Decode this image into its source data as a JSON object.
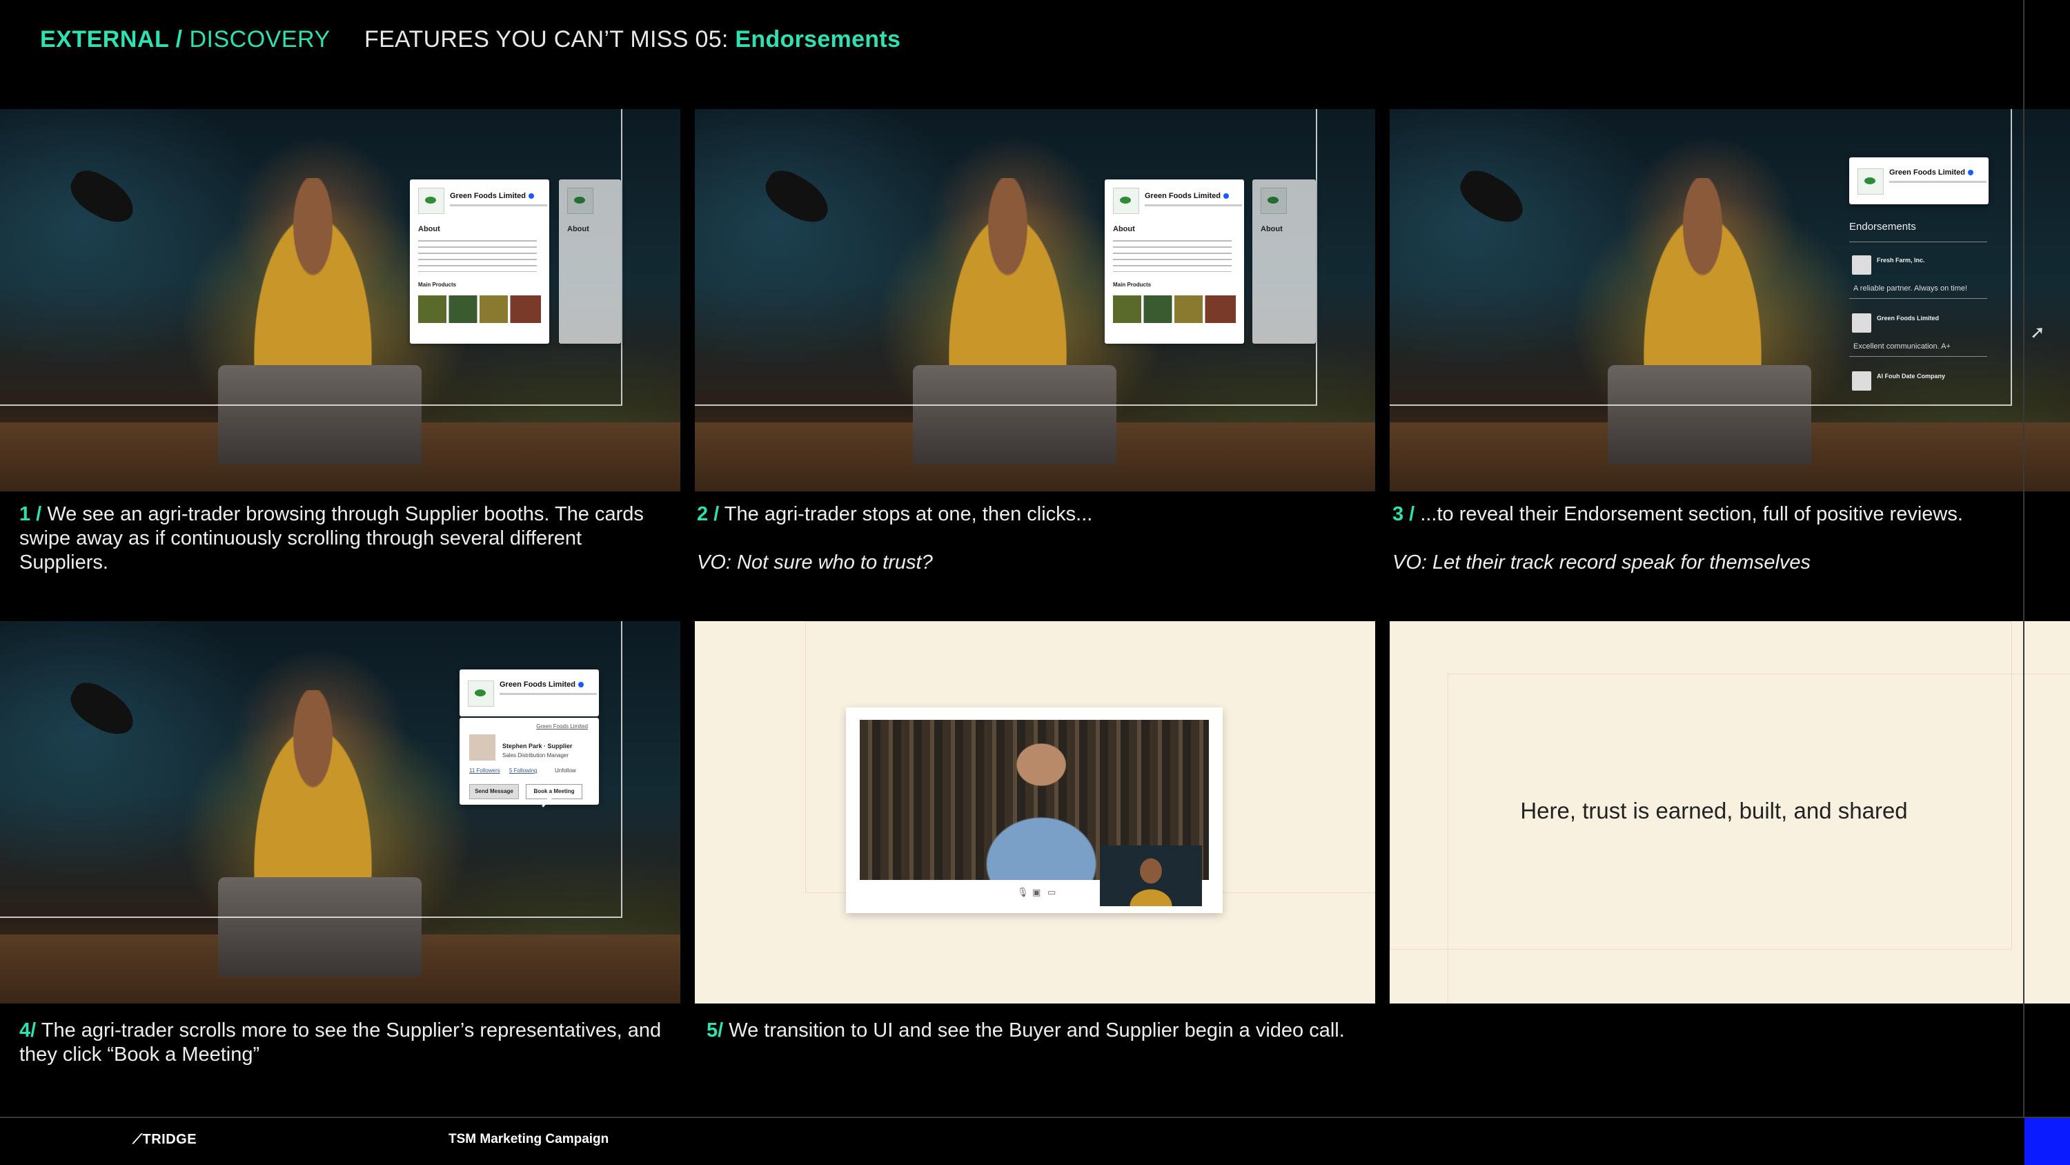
{
  "header": {
    "section_bold": "EXTERNAL /",
    "section_light": "DISCOVERY",
    "feature_prefix": "FEATURES YOU CAN’T MISS 05:",
    "feature_highlight": "Endorsements"
  },
  "panels": [
    {
      "num": "1 /",
      "text": "We see an agri-trader browsing through Supplier booths. The cards swipe away as if continuously scrolling through several different Suppliers.",
      "vo": ""
    },
    {
      "num": "2 /",
      "text": "The agri-trader stops at one, then clicks...",
      "vo": "VO: Not sure who to trust?"
    },
    {
      "num": "3 /",
      "text": "...to reveal their Endorsement section, full of positive reviews.",
      "vo": "VO: Let their track record speak for themselves"
    },
    {
      "num": "4/",
      "text": "The agri-trader scrolls more to see the Supplier’s representatives, and they click  “Book a Meeting”",
      "vo": ""
    },
    {
      "num": "5/",
      "text": "We transition to UI and see the Buyer and Supplier begin a video call.",
      "vo": ""
    }
  ],
  "card": {
    "company": "Green Foods Limited",
    "about": "About",
    "products": "Main Products"
  },
  "endorsements": {
    "title": "Endorsements",
    "items": [
      {
        "name": "Fresh Farm, Inc.",
        "quote": "A reliable partner. Always on time!"
      },
      {
        "name": "Green Foods Limited",
        "quote": "Excellent communication. A+"
      },
      {
        "name": "Al Fouh Date Company",
        "quote": ""
      }
    ]
  },
  "rep_card": {
    "name": "Stephen Park · Supplier",
    "role": "Sales Distribution Manager",
    "followers": "11 Followers",
    "following": "5 Following",
    "unfollow": "Unfollow",
    "send_message": "Send Message",
    "book_meeting": "Book a Meeting"
  },
  "tagline": "Here, trust is earned, built, and shared",
  "footer": {
    "logo": "⟋TRIDGE",
    "campaign": "TSM Marketing Campaign"
  },
  "colors": {
    "accent": "#2fe0b0",
    "cream": "#f9f1e0",
    "footer_block": "#0a1cff"
  }
}
